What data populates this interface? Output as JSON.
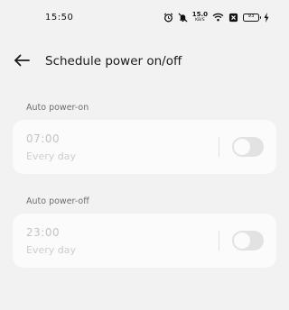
{
  "status_bar": {
    "time": "15:50",
    "net_speed_value": "15.0",
    "net_speed_unit": "KB/S",
    "battery_level": "93",
    "icons": [
      "alarm-icon",
      "mute-icon",
      "wifi-icon",
      "sim-off-icon",
      "battery-icon",
      "charging-icon"
    ]
  },
  "header": {
    "title": "Schedule power on/off",
    "back_icon": "arrow-left-icon"
  },
  "schedules": [
    {
      "section_label": "Auto power-on",
      "time": "07:00",
      "repeat": "Every day",
      "enabled": false
    },
    {
      "section_label": "Auto power-off",
      "time": "23:00",
      "repeat": "Every day",
      "enabled": false
    }
  ],
  "colors": {
    "background": "#f2f2f2",
    "card": "#fbfbfb",
    "toggle_off": "#e2e2e2",
    "disabled_text": "#c4c4c4"
  }
}
